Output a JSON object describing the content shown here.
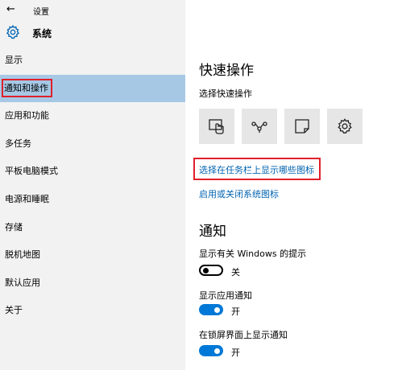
{
  "window": {
    "title": "设置"
  },
  "header": {
    "title": "系统",
    "icon": "gear-icon"
  },
  "sidebar": {
    "items": [
      {
        "label": "显示"
      },
      {
        "label": "通知和操作"
      },
      {
        "label": "应用和功能"
      },
      {
        "label": "多任务"
      },
      {
        "label": "平板电脑模式"
      },
      {
        "label": "电源和睡眠"
      },
      {
        "label": "存储"
      },
      {
        "label": "脱机地图"
      },
      {
        "label": "默认应用"
      },
      {
        "label": "关于"
      }
    ],
    "selected_label": "通知和操作"
  },
  "quick_actions": {
    "heading": "快速操作",
    "subheading": "选择快速操作",
    "tiles": [
      "tablet-mode-icon",
      "connect-icon",
      "note-icon",
      "settings-icon"
    ]
  },
  "links": {
    "taskbar_icons": "选择在任务栏上显示哪些图标",
    "system_icons": "启用或关闭系统图标"
  },
  "notifications": {
    "heading": "通知",
    "settings": [
      {
        "label": "显示有关 Windows 的提示",
        "state": "关",
        "on": false
      },
      {
        "label": "显示应用通知",
        "state": "开",
        "on": true
      },
      {
        "label": "在锁屏界面上显示通知",
        "state": "开",
        "on": true
      }
    ]
  },
  "colors": {
    "accent": "#0078d7",
    "link": "#0063b1",
    "selection": "#a6c8e5",
    "highlight": "#e0202a"
  }
}
